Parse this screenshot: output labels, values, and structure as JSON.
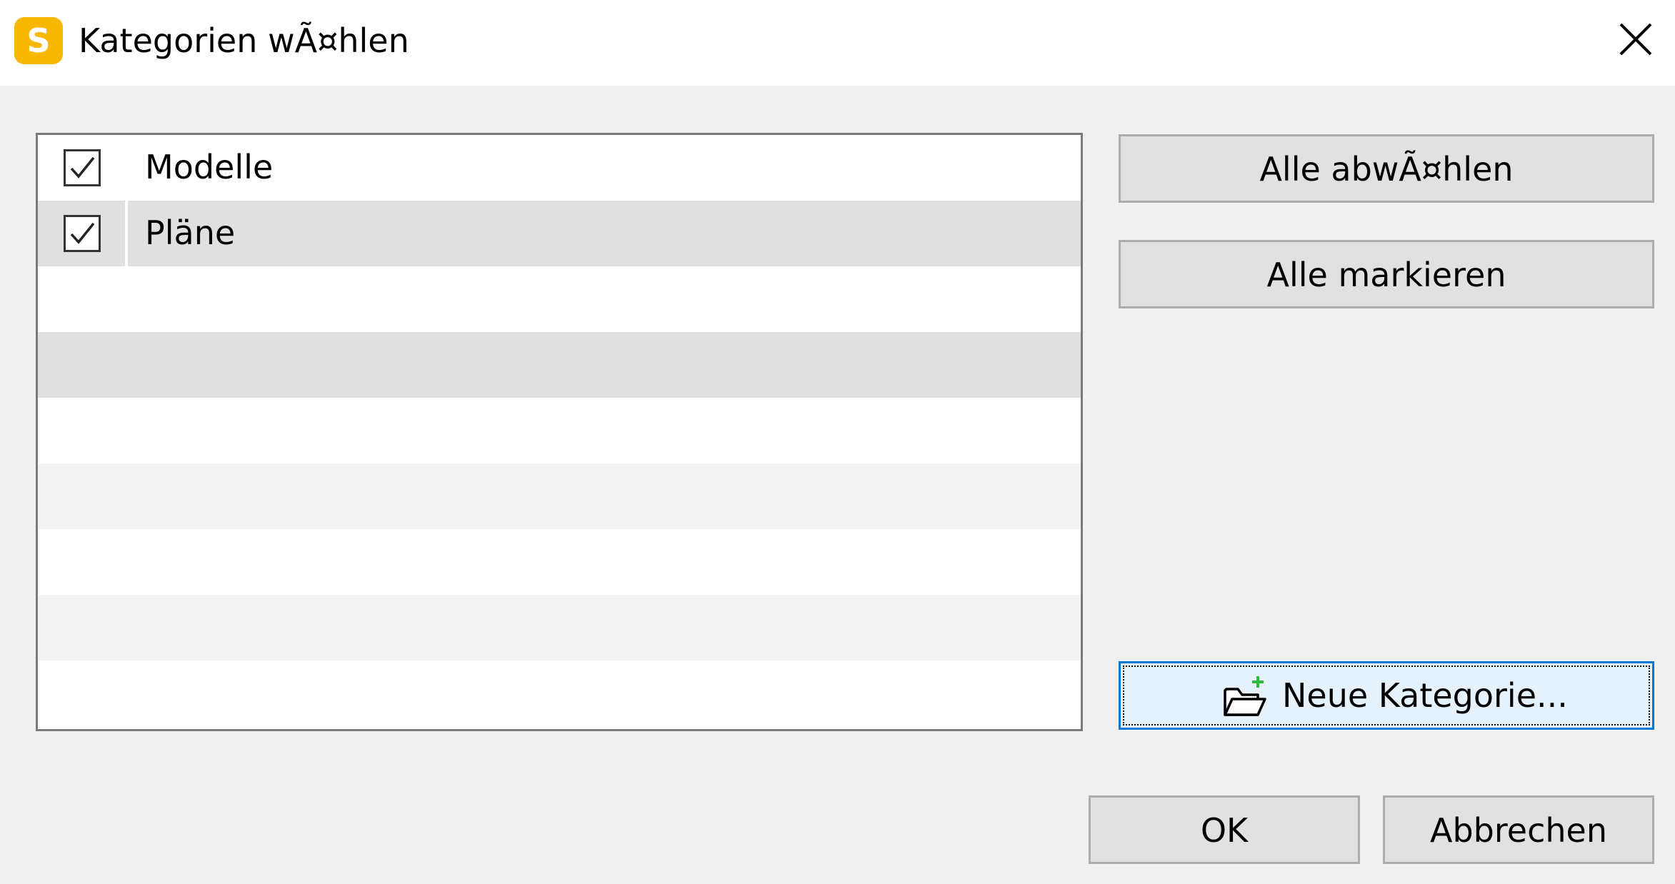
{
  "window": {
    "title": "Kategorien wÃ¤hlen",
    "app_icon_letter": "S",
    "app_icon_color": "#f9b800"
  },
  "list": {
    "items": [
      {
        "label": "Modelle",
        "checked": true
      },
      {
        "label": "Pläne",
        "checked": true
      }
    ]
  },
  "buttons": {
    "deselect_all": "Alle abwÃ¤hlen",
    "mark_all": "Alle markieren",
    "new_category": "Neue Kategorie...",
    "ok": "OK",
    "cancel": "Abbrechen"
  },
  "icons": {
    "close": "close-icon",
    "checkbox": "checkmark-icon",
    "new_category": "folder-add-icon"
  },
  "colors": {
    "focus_border": "#0078d7",
    "focus_fill": "#e5f1fb",
    "folder_plus": "#2dbb3c"
  }
}
